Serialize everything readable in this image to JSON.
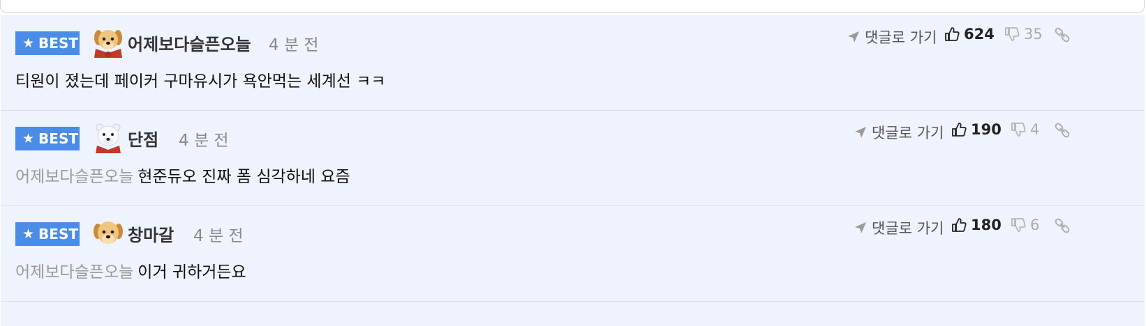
{
  "comments": [
    {
      "badge": "BEST",
      "avatar_icon": "puppy-red-scarf-icon",
      "nickname": "어제보다슬픈오늘",
      "time": "4 분 전",
      "reply_to": "",
      "text": "티원이 졌는데 페이커 구마유시가 욕안먹는 세계선 ㅋㅋ",
      "goto_label": "댓글로 가기",
      "likes": "624",
      "dislikes": "35"
    },
    {
      "badge": "BEST",
      "avatar_icon": "polar-bear-icon",
      "nickname": "단점",
      "time": "4 분 전",
      "reply_to": "어제보다슬픈오늘",
      "text": "현준듀오 진짜 폼 심각하네 요즘",
      "goto_label": "댓글로 가기",
      "likes": "190",
      "dislikes": "4"
    },
    {
      "badge": "BEST",
      "avatar_icon": "puppy-icon",
      "nickname": "창마갈",
      "time": "4 분 전",
      "reply_to": "어제보다슬픈오늘",
      "text": "이거 귀하거든요",
      "goto_label": "댓글로 가기",
      "likes": "180",
      "dislikes": "6"
    }
  ],
  "colors": {
    "badge": "#4a8ce8",
    "comment_bg": "#eef3fd",
    "muted": "#9a9a9a"
  }
}
